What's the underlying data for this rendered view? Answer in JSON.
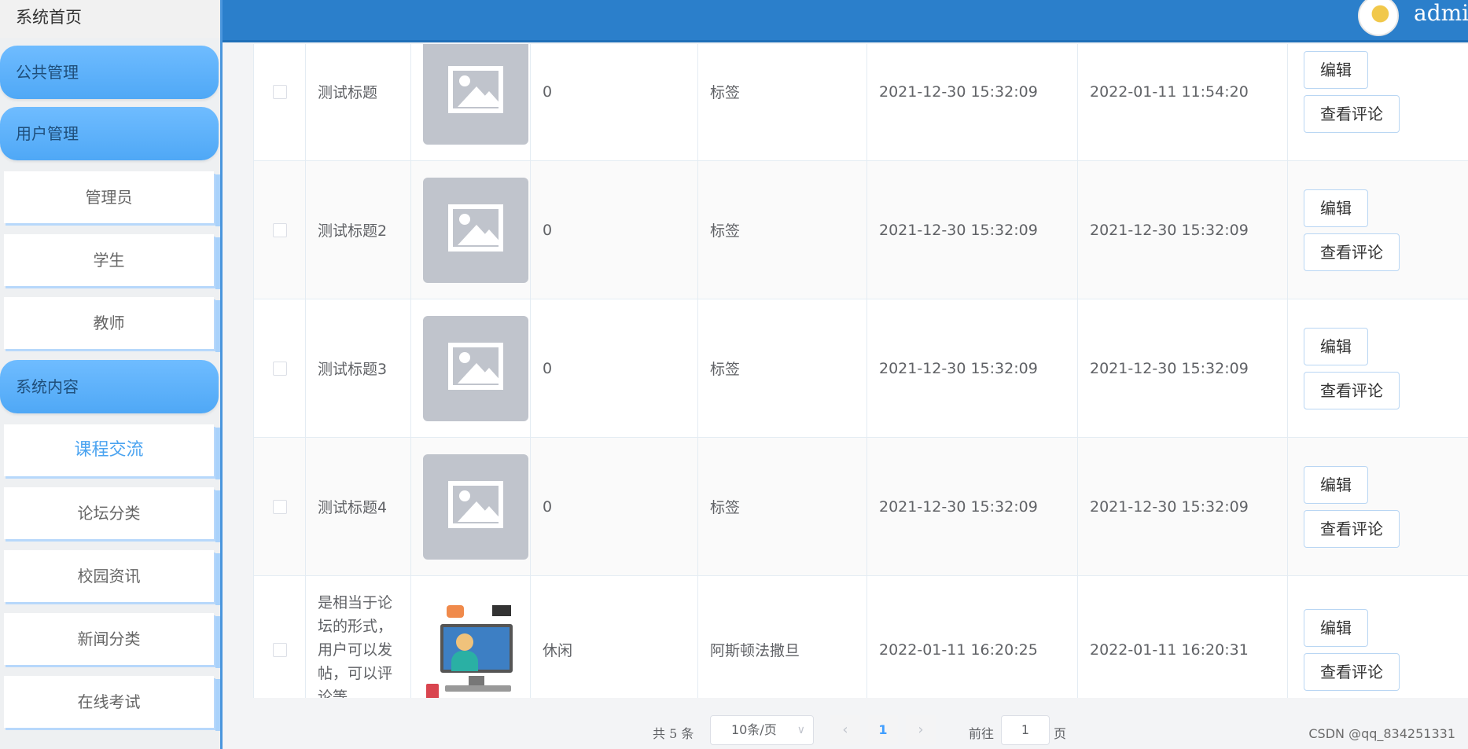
{
  "sidebar": {
    "home": "系统首页",
    "groups": [
      {
        "label": "公共管理"
      },
      {
        "label": "用户管理",
        "items": [
          "管理员",
          "学生",
          "教师"
        ]
      },
      {
        "label": "系统内容",
        "items": [
          "课程交流",
          "论坛分类",
          "校园资讯",
          "新闻分类",
          "在线考试"
        ]
      }
    ],
    "active_item": "课程交流"
  },
  "header": {
    "username": "admin",
    "avatar_icon": "avatar-icon"
  },
  "table": {
    "rows": [
      {
        "title": "测试标题",
        "image": "image-placeholder-icon",
        "category": "0",
        "tags": "标签",
        "created": "2021-12-30 15:32:09",
        "updated": "2022-01-11 11:54:20",
        "edit": "编辑",
        "view_comments": "查看评论"
      },
      {
        "title": "测试标题2",
        "image": "image-placeholder-icon",
        "category": "0",
        "tags": "标签",
        "created": "2021-12-30 15:32:09",
        "updated": "2021-12-30 15:32:09",
        "edit": "编辑",
        "view_comments": "查看评论"
      },
      {
        "title": "测试标题3",
        "image": "image-placeholder-icon",
        "category": "0",
        "tags": "标签",
        "created": "2021-12-30 15:32:09",
        "updated": "2021-12-30 15:32:09",
        "edit": "编辑",
        "view_comments": "查看评论"
      },
      {
        "title": "测试标题4",
        "image": "image-placeholder-icon",
        "category": "0",
        "tags": "标签",
        "created": "2021-12-30 15:32:09",
        "updated": "2021-12-30 15:32:09",
        "edit": "编辑",
        "view_comments": "查看评论"
      },
      {
        "title": "是相当于论坛的形式，用户可以发帖，可以评论等",
        "image": "online-learning-illustration",
        "category": "休闲",
        "tags": "阿斯顿法撒旦",
        "created": "2022-01-11 16:20:25",
        "updated": "2022-01-11 16:20:31",
        "edit": "编辑",
        "view_comments": "查看评论"
      }
    ]
  },
  "pagination": {
    "total": "共 5 条",
    "page_size": "10条/页",
    "prev": "‹",
    "current_page": "1",
    "next": "›",
    "goto_label": "前往",
    "goto_value": "1",
    "page_suffix": "页"
  },
  "watermark": "CSDN @qq_834251331"
}
